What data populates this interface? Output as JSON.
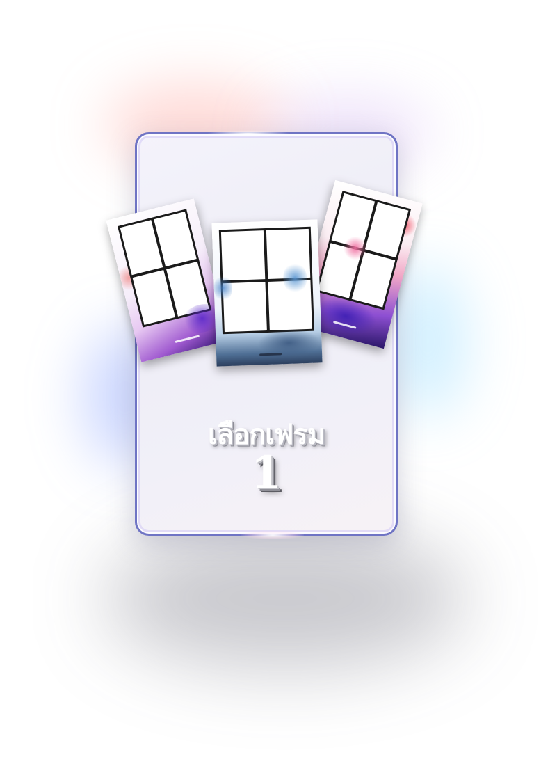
{
  "card": {
    "title": "เลือกเฟรม",
    "number": "1",
    "border_color": "#6f74c4"
  },
  "frames": [
    {
      "name": "purple-floral-frame",
      "theme_color": "#8d4fd2"
    },
    {
      "name": "jellyfish-ocean-frame",
      "theme_color": "#4f6f95"
    },
    {
      "name": "pink-tropical-frame",
      "theme_color": "#f1a7c6"
    }
  ]
}
